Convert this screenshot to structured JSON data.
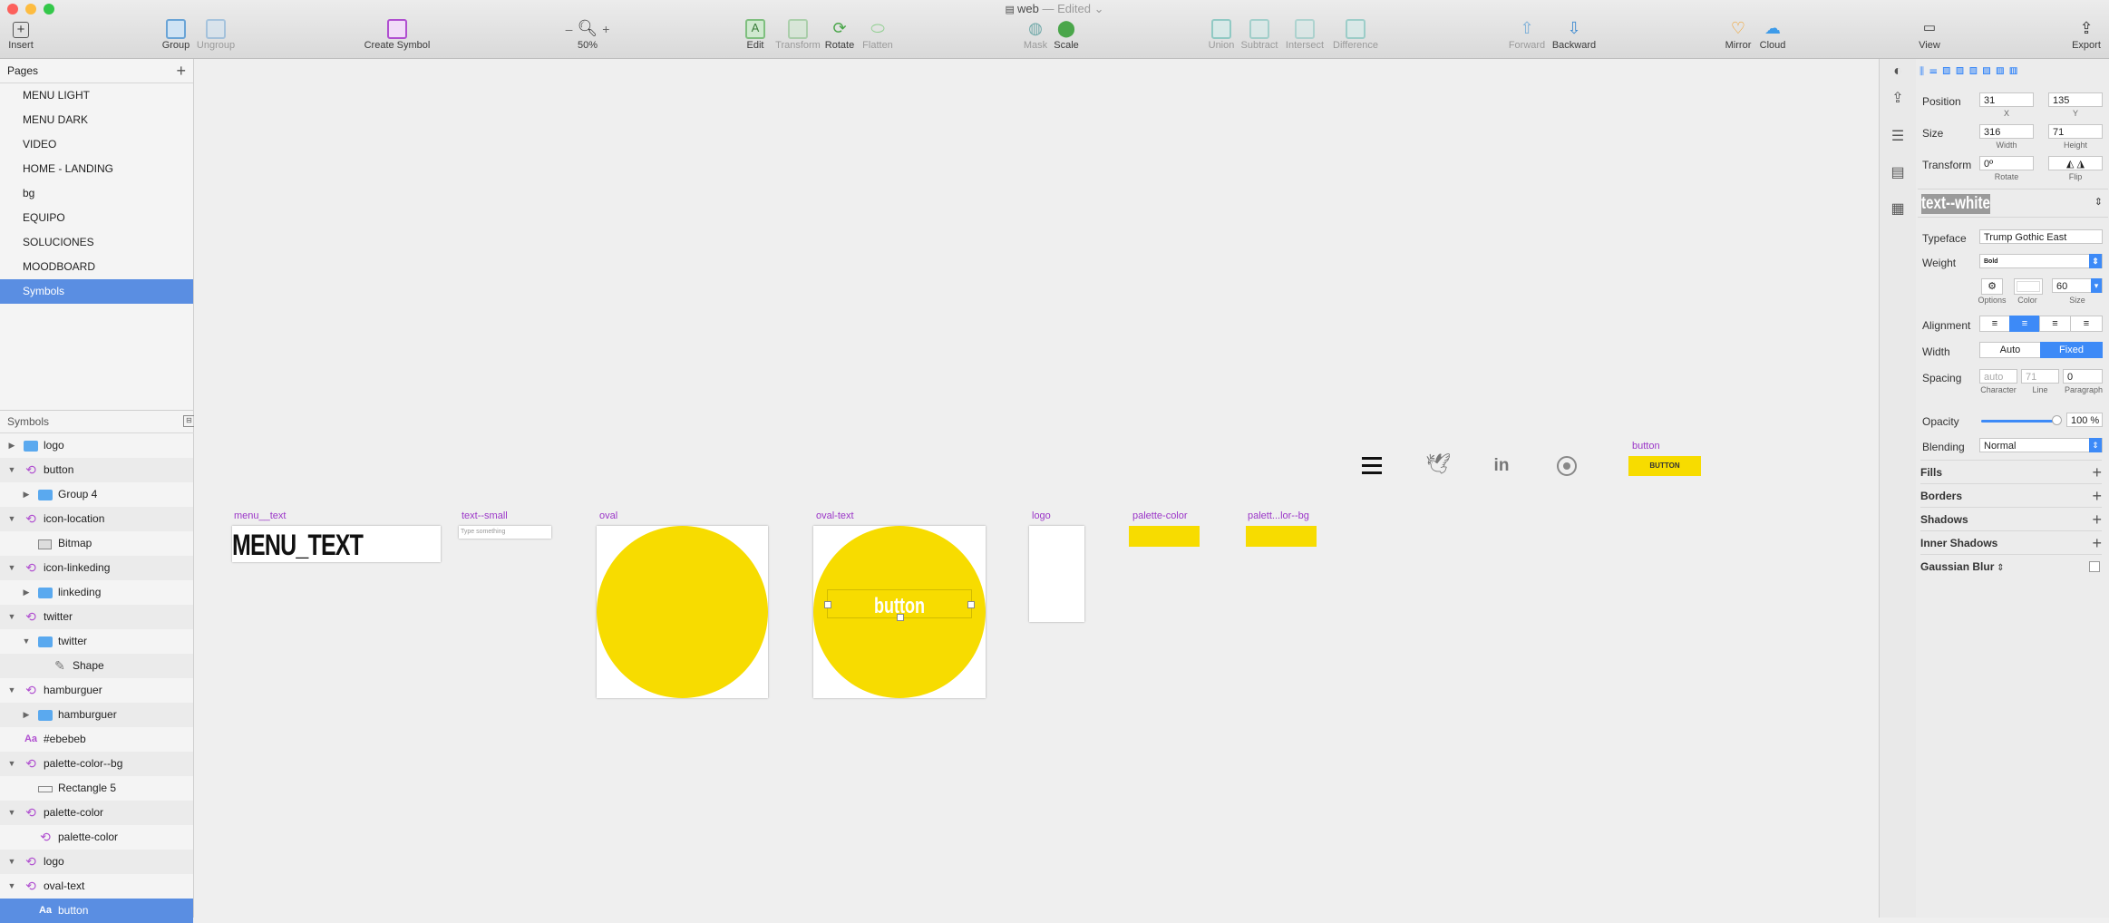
{
  "window": {
    "title": "web",
    "status": "— Edited",
    "traffic_colors": [
      "#fc605b",
      "#fdbc40",
      "#34c84a"
    ]
  },
  "toolbar": {
    "insert": "Insert",
    "group": "Group",
    "ungroup": "Ungroup",
    "create_symbol": "Create Symbol",
    "zoom_minus": "–",
    "zoom_plus": "+",
    "zoom": "50%",
    "edit": "Edit",
    "transform": "Transform",
    "rotate": "Rotate",
    "flatten": "Flatten",
    "mask": "Mask",
    "scale": "Scale",
    "union": "Union",
    "subtract": "Subtract",
    "intersect": "Intersect",
    "difference": "Difference",
    "forward": "Forward",
    "backward": "Backward",
    "mirror": "Mirror",
    "cloud": "Cloud",
    "view": "View",
    "export": "Export"
  },
  "pages": {
    "header": "Pages",
    "items": [
      "MENU LIGHT",
      "MENU DARK",
      "VIDEO",
      "HOME - LANDING",
      "bg",
      "EQUIPO",
      "SOLUCIONES",
      "MOODBOARD",
      "Symbols"
    ],
    "selected_index": 8
  },
  "symbols_panel": {
    "header": "Symbols",
    "layers": [
      {
        "name": "logo",
        "kind": "folder",
        "depth": 0,
        "arrow": "right"
      },
      {
        "name": "button",
        "kind": "symbol",
        "depth": 0,
        "arrow": "down"
      },
      {
        "name": "Group 4",
        "kind": "folder",
        "depth": 1,
        "arrow": "right"
      },
      {
        "name": "icon-location",
        "kind": "symbol",
        "depth": 0,
        "arrow": "down"
      },
      {
        "name": "Bitmap",
        "kind": "image",
        "depth": 1,
        "arrow": ""
      },
      {
        "name": "icon-linkeding",
        "kind": "symbol",
        "depth": 0,
        "arrow": "down"
      },
      {
        "name": "linkeding",
        "kind": "folder",
        "depth": 1,
        "arrow": "right"
      },
      {
        "name": "twitter",
        "kind": "symbol",
        "depth": 0,
        "arrow": "down"
      },
      {
        "name": "twitter",
        "kind": "folder",
        "depth": 1,
        "arrow": "down"
      },
      {
        "name": "Shape",
        "kind": "shape",
        "depth": 2,
        "arrow": ""
      },
      {
        "name": "hamburguer",
        "kind": "symbol",
        "depth": 0,
        "arrow": "down"
      },
      {
        "name": "hamburguer",
        "kind": "folder",
        "depth": 1,
        "arrow": "right"
      },
      {
        "name": "#ebebeb",
        "kind": "text",
        "depth": 0,
        "arrow": ""
      },
      {
        "name": "palette-color--bg",
        "kind": "symbol",
        "depth": 0,
        "arrow": "down"
      },
      {
        "name": "Rectangle 5",
        "kind": "rect",
        "depth": 1,
        "arrow": ""
      },
      {
        "name": "palette-color",
        "kind": "symbol",
        "depth": 0,
        "arrow": "down"
      },
      {
        "name": "palette-color",
        "kind": "symbol",
        "depth": 1,
        "arrow": ""
      },
      {
        "name": "logo",
        "kind": "symbol",
        "depth": 0,
        "arrow": "down"
      },
      {
        "name": "oval-text",
        "kind": "symbol",
        "depth": 0,
        "arrow": "down"
      },
      {
        "name": "button",
        "kind": "text",
        "depth": 1,
        "arrow": "",
        "selected": true
      }
    ]
  },
  "canvas": {
    "artboards": {
      "menu_text": {
        "label": "menu__text",
        "content": "MENU_TEXT"
      },
      "text_small": {
        "label": "text--small",
        "content": "Type something"
      },
      "oval": {
        "label": "oval"
      },
      "oval_text": {
        "label": "oval-text",
        "content": "button"
      },
      "logo": {
        "label": "logo"
      },
      "palette_color": {
        "label": "palette-color"
      },
      "palette_bg": {
        "label": "palett...lor--bg"
      },
      "button": {
        "label": "button",
        "content": "BUTTON"
      }
    },
    "accent_color": "#f7dc00",
    "label_color": "#9b36c8",
    "icons": [
      "hamburger-icon",
      "twitter-icon",
      "linkedin-icon",
      "location-icon"
    ]
  },
  "inspector": {
    "position": {
      "label": "Position",
      "x": "31",
      "y": "135",
      "x_label": "X",
      "y_label": "Y"
    },
    "size": {
      "label": "Size",
      "width": "316",
      "height": "71",
      "w_label": "Width",
      "h_label": "Height"
    },
    "transform": {
      "label": "Transform",
      "rotate": "0º",
      "rotate_label": "Rotate",
      "flip_label": "Flip"
    },
    "text_style": "text--white",
    "typeface": {
      "label": "Typeface",
      "value": "Trump Gothic East"
    },
    "weight": {
      "label": "Weight",
      "value": "Bold"
    },
    "options_label": "Options",
    "color_label": "Color",
    "font_size": {
      "value": "60",
      "label": "Size"
    },
    "alignment": {
      "label": "Alignment"
    },
    "width_mode": {
      "label": "Width",
      "auto": "Auto",
      "fixed": "Fixed"
    },
    "spacing": {
      "label": "Spacing",
      "character": "auto",
      "line": "71",
      "paragraph": "0",
      "character_label": "Character",
      "line_label": "Line",
      "paragraph_label": "Paragraph"
    },
    "opacity": {
      "label": "Opacity",
      "value": "100 %",
      "level": 1.0
    },
    "blending": {
      "label": "Blending",
      "value": "Normal"
    },
    "sections": [
      "Fills",
      "Borders",
      "Shadows",
      "Inner Shadows",
      "Gaussian Blur"
    ]
  }
}
